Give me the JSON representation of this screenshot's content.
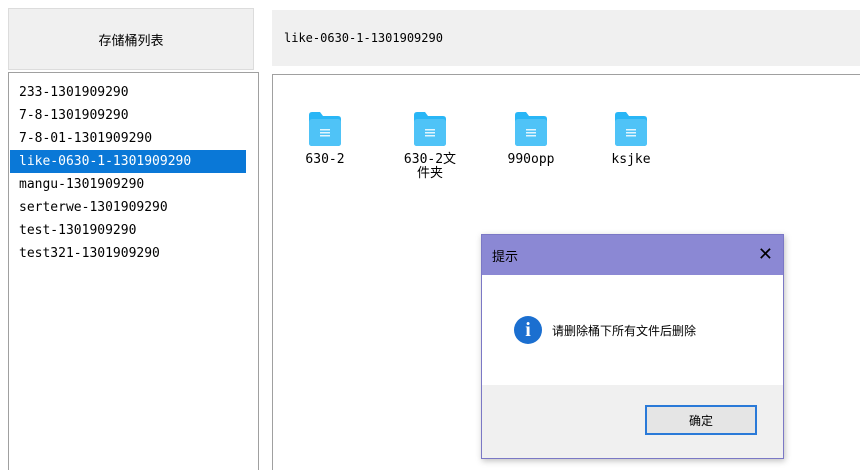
{
  "sidebar": {
    "title": "存储桶列表",
    "buckets": [
      "233-1301909290",
      "7-8-1301909290",
      "7-8-01-1301909290",
      "like-0630-1-1301909290",
      "mangu-1301909290",
      "serterwe-1301909290",
      "test-1301909290",
      "test321-1301909290"
    ],
    "selected_bucket": "like-0630-1-1301909290"
  },
  "path_bar": {
    "current_bucket": "like-0630-1-1301909290"
  },
  "files": {
    "folders": [
      {
        "name": "630-2",
        "icon": "folder-icon"
      },
      {
        "name": "630-2文件夹",
        "icon": "folder-icon"
      },
      {
        "name": "990opp",
        "icon": "folder-icon"
      },
      {
        "name": "ksjke",
        "icon": "folder-icon"
      }
    ]
  },
  "dialog": {
    "title": "提示",
    "message": "请删除桶下所有文件后删除",
    "ok_label": "确定",
    "close_glyph": "✕",
    "info_glyph": "i"
  },
  "colors": {
    "selection": "#0a78d7",
    "dialog_title_bg": "#8b88d4",
    "info_icon": "#1b6fd0",
    "folder_icon": "#29b6f6"
  }
}
